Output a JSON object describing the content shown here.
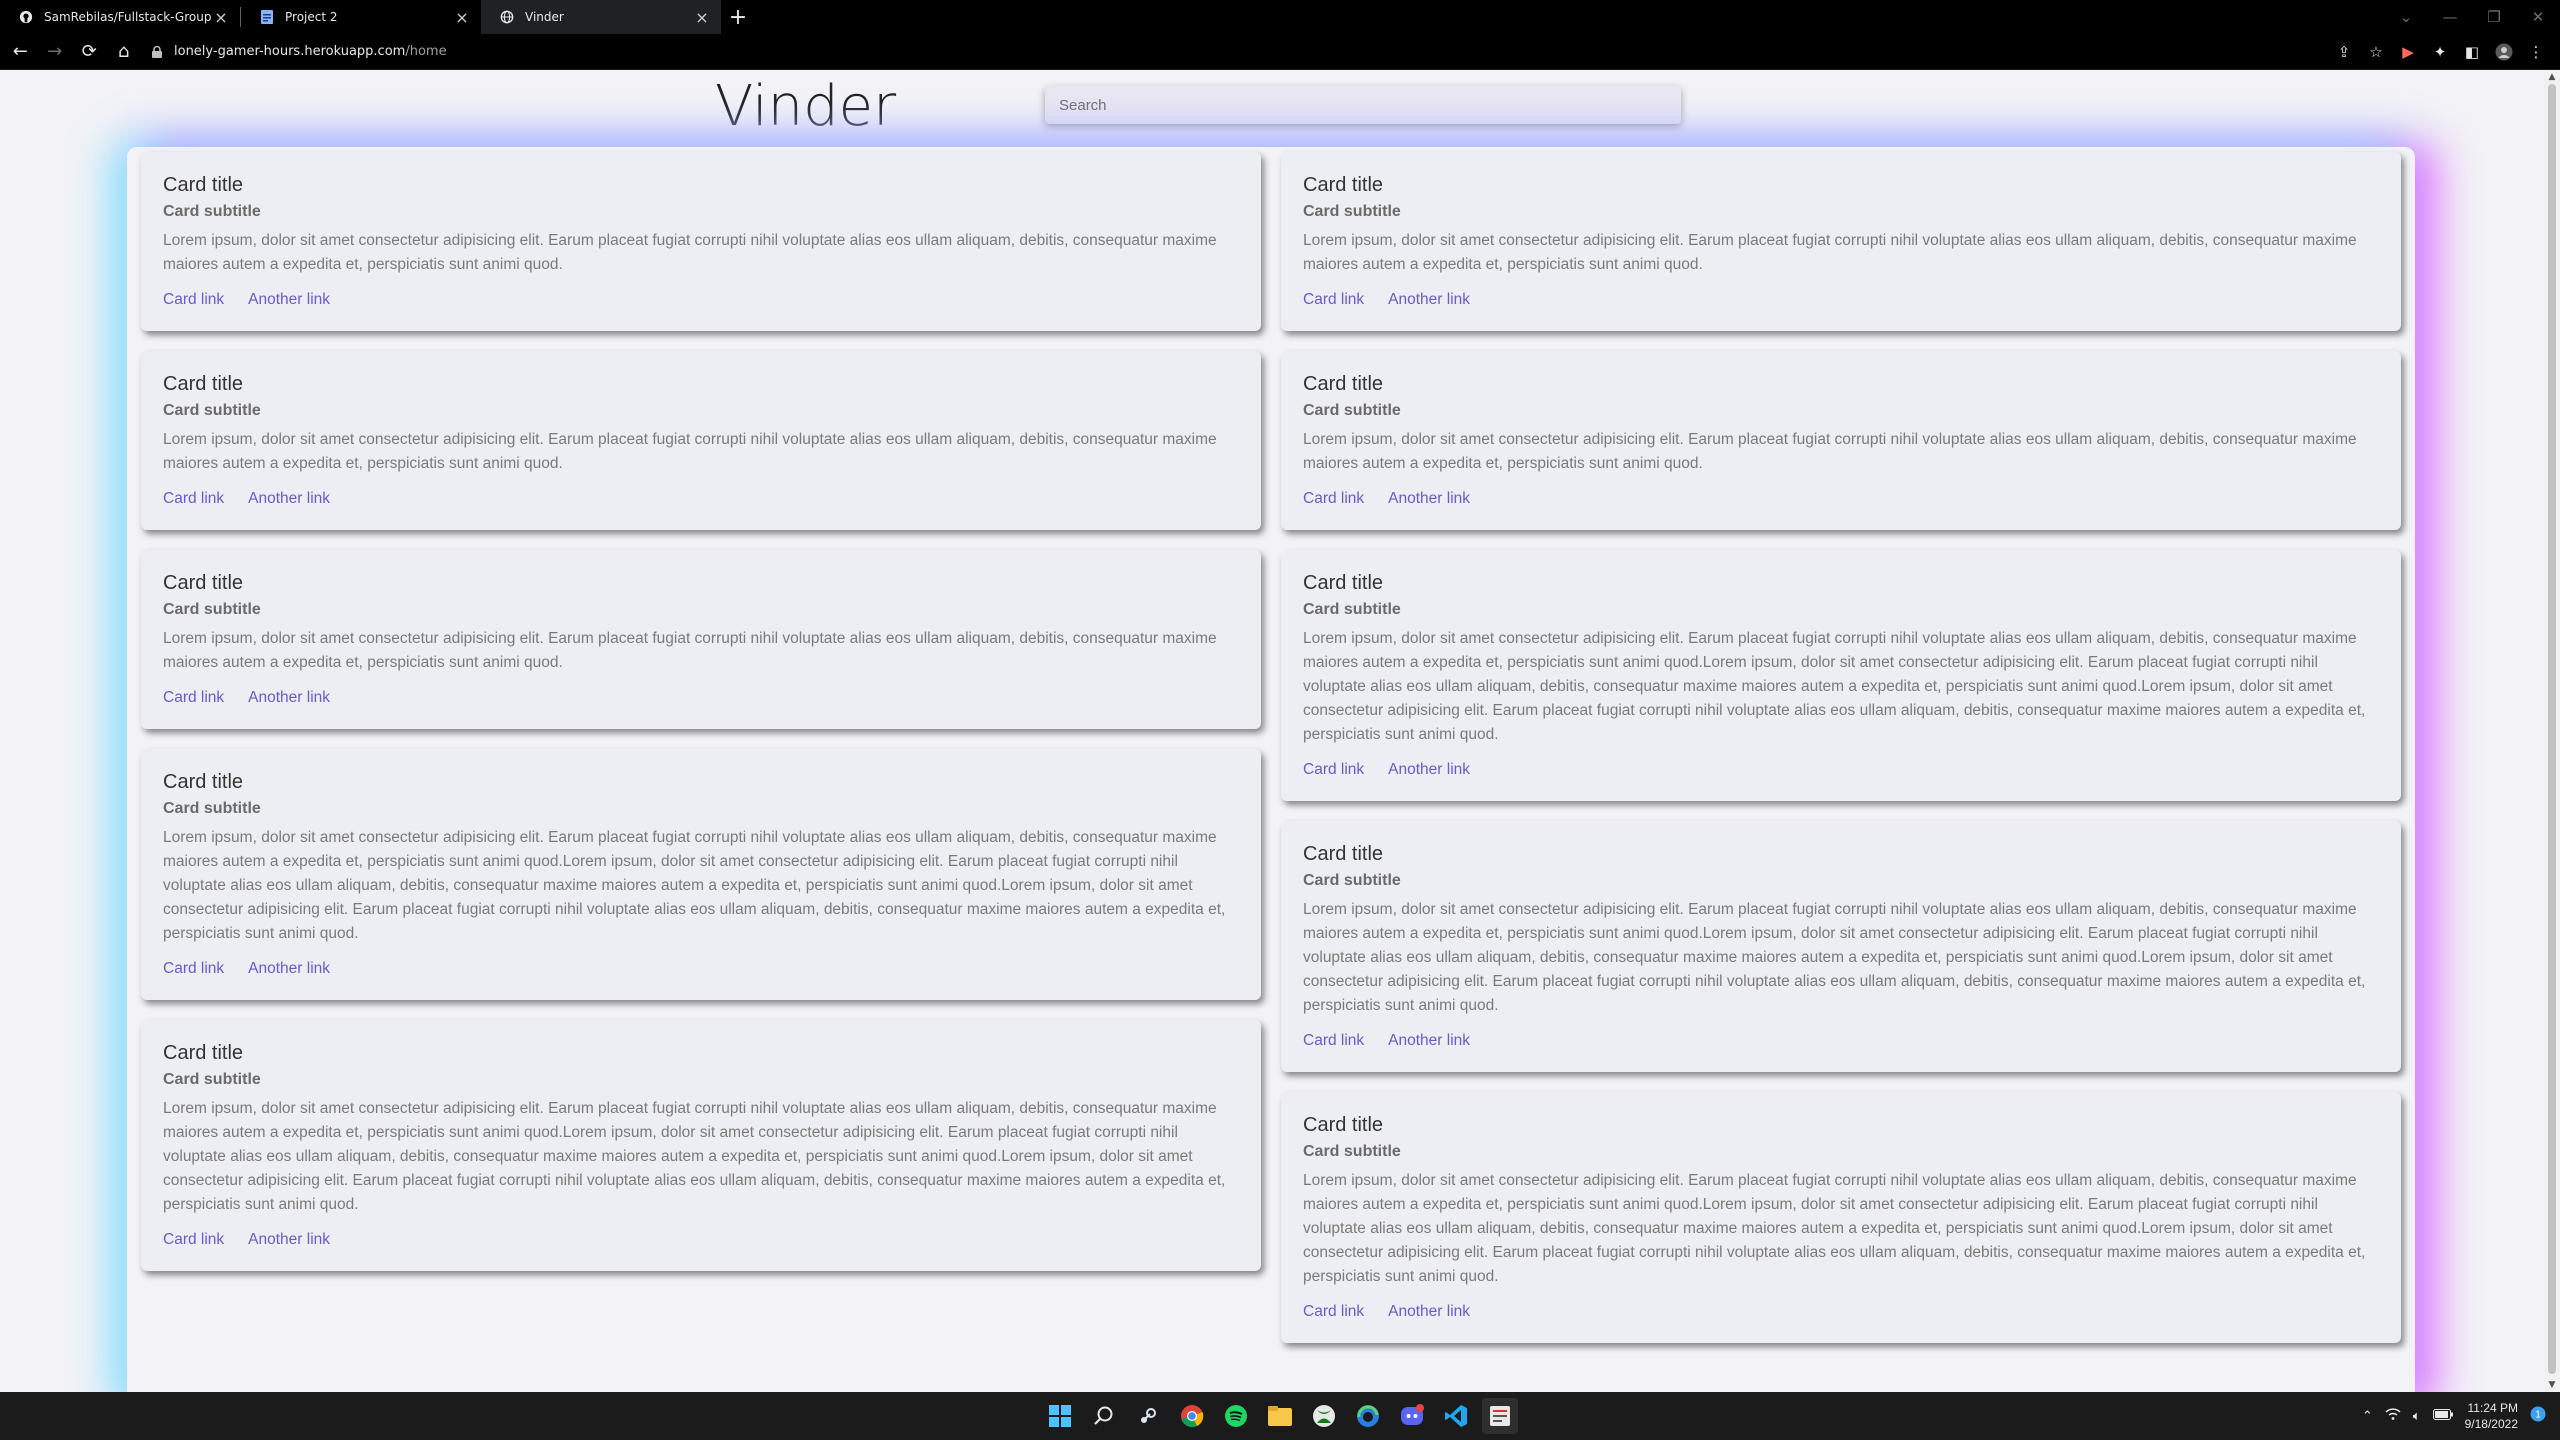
{
  "browser": {
    "tabs": [
      {
        "label": "SamRebilas/Fullstack-Group-Proj",
        "icon": "github-icon"
      },
      {
        "label": "Project 2",
        "icon": "docs-icon"
      },
      {
        "label": "Vinder",
        "icon": "globe-icon",
        "active": true
      }
    ],
    "url_host": "lonely-gamer-hours.herokuapp.com",
    "url_path": "/home"
  },
  "site": {
    "title": "Vinder",
    "search_placeholder": "Search"
  },
  "cards": {
    "left": [
      {
        "title": "Card title",
        "subtitle": "Card subtitle",
        "text": "Lorem ipsum, dolor sit amet consectetur adipisicing elit. Earum placeat fugiat corrupti nihil voluptate alias eos ullam aliquam, debitis, consequatur maxime maiores autem a expedita et, perspiciatis sunt animi quod.",
        "link1": "Card link",
        "link2": "Another link"
      },
      {
        "title": "Card title",
        "subtitle": "Card subtitle",
        "text": "Lorem ipsum, dolor sit amet consectetur adipisicing elit. Earum placeat fugiat corrupti nihil voluptate alias eos ullam aliquam, debitis, consequatur maxime maiores autem a expedita et, perspiciatis sunt animi quod.",
        "link1": "Card link",
        "link2": "Another link"
      },
      {
        "title": "Card title",
        "subtitle": "Card subtitle",
        "text": "Lorem ipsum, dolor sit amet consectetur adipisicing elit. Earum placeat fugiat corrupti nihil voluptate alias eos ullam aliquam, debitis, consequatur maxime maiores autem a expedita et, perspiciatis sunt animi quod.",
        "link1": "Card link",
        "link2": "Another link"
      },
      {
        "title": "Card title",
        "subtitle": "Card subtitle",
        "text": "Lorem ipsum, dolor sit amet consectetur adipisicing elit. Earum placeat fugiat corrupti nihil voluptate alias eos ullam aliquam, debitis, consequatur maxime maiores autem a expedita et, perspiciatis sunt animi quod.Lorem ipsum, dolor sit amet consectetur adipisicing elit. Earum placeat fugiat corrupti nihil voluptate alias eos ullam aliquam, debitis, consequatur maxime maiores autem a expedita et, perspiciatis sunt animi quod.Lorem ipsum, dolor sit amet consectetur adipisicing elit. Earum placeat fugiat corrupti nihil voluptate alias eos ullam aliquam, debitis, consequatur maxime maiores autem a expedita et, perspiciatis sunt animi quod.",
        "link1": "Card link",
        "link2": "Another link"
      },
      {
        "title": "Card title",
        "subtitle": "Card subtitle",
        "text": "Lorem ipsum, dolor sit amet consectetur adipisicing elit. Earum placeat fugiat corrupti nihil voluptate alias eos ullam aliquam, debitis, consequatur maxime maiores autem a expedita et, perspiciatis sunt animi quod.Lorem ipsum, dolor sit amet consectetur adipisicing elit. Earum placeat fugiat corrupti nihil voluptate alias eos ullam aliquam, debitis, consequatur maxime maiores autem a expedita et, perspiciatis sunt animi quod.Lorem ipsum, dolor sit amet consectetur adipisicing elit. Earum placeat fugiat corrupti nihil voluptate alias eos ullam aliquam, debitis, consequatur maxime maiores autem a expedita et, perspiciatis sunt animi quod.",
        "link1": "Card link",
        "link2": "Another link"
      }
    ],
    "right": [
      {
        "title": "Card title",
        "subtitle": "Card subtitle",
        "text": "Lorem ipsum, dolor sit amet consectetur adipisicing elit. Earum placeat fugiat corrupti nihil voluptate alias eos ullam aliquam, debitis, consequatur maxime maiores autem a expedita et, perspiciatis sunt animi quod.",
        "link1": "Card link",
        "link2": "Another link"
      },
      {
        "title": "Card title",
        "subtitle": "Card subtitle",
        "text": "Lorem ipsum, dolor sit amet consectetur adipisicing elit. Earum placeat fugiat corrupti nihil voluptate alias eos ullam aliquam, debitis, consequatur maxime maiores autem a expedita et, perspiciatis sunt animi quod.",
        "link1": "Card link",
        "link2": "Another link"
      },
      {
        "title": "Card title",
        "subtitle": "Card subtitle",
        "text": "Lorem ipsum, dolor sit amet consectetur adipisicing elit. Earum placeat fugiat corrupti nihil voluptate alias eos ullam aliquam, debitis, consequatur maxime maiores autem a expedita et, perspiciatis sunt animi quod.Lorem ipsum, dolor sit amet consectetur adipisicing elit. Earum placeat fugiat corrupti nihil voluptate alias eos ullam aliquam, debitis, consequatur maxime maiores autem a expedita et, perspiciatis sunt animi quod.Lorem ipsum, dolor sit amet consectetur adipisicing elit. Earum placeat fugiat corrupti nihil voluptate alias eos ullam aliquam, debitis, consequatur maxime maiores autem a expedita et, perspiciatis sunt animi quod.",
        "link1": "Card link",
        "link2": "Another link"
      },
      {
        "title": "Card title",
        "subtitle": "Card subtitle",
        "text": "Lorem ipsum, dolor sit amet consectetur adipisicing elit. Earum placeat fugiat corrupti nihil voluptate alias eos ullam aliquam, debitis, consequatur maxime maiores autem a expedita et, perspiciatis sunt animi quod.Lorem ipsum, dolor sit amet consectetur adipisicing elit. Earum placeat fugiat corrupti nihil voluptate alias eos ullam aliquam, debitis, consequatur maxime maiores autem a expedita et, perspiciatis sunt animi quod.Lorem ipsum, dolor sit amet consectetur adipisicing elit. Earum placeat fugiat corrupti nihil voluptate alias eos ullam aliquam, debitis, consequatur maxime maiores autem a expedita et, perspiciatis sunt animi quod.",
        "link1": "Card link",
        "link2": "Another link"
      },
      {
        "title": "Card title",
        "subtitle": "Card subtitle",
        "text": "Lorem ipsum, dolor sit amet consectetur adipisicing elit. Earum placeat fugiat corrupti nihil voluptate alias eos ullam aliquam, debitis, consequatur maxime maiores autem a expedita et, perspiciatis sunt animi quod.Lorem ipsum, dolor sit amet consectetur adipisicing elit. Earum placeat fugiat corrupti nihil voluptate alias eos ullam aliquam, debitis, consequatur maxime maiores autem a expedita et, perspiciatis sunt animi quod.Lorem ipsum, dolor sit amet consectetur adipisicing elit. Earum placeat fugiat corrupti nihil voluptate alias eos ullam aliquam, debitis, consequatur maxime maiores autem a expedita et, perspiciatis sunt animi quod.",
        "link1": "Card link",
        "link2": "Another link"
      }
    ]
  },
  "taskbar": {
    "apps": [
      "windows-start-icon",
      "search-icon",
      "steam-icon",
      "chrome-icon",
      "spotify-icon",
      "file-explorer-icon",
      "xbox-icon",
      "edge-icon",
      "discord-icon",
      "vscode-icon",
      "active-app-icon"
    ],
    "time": "11:24 PM",
    "date": "9/18/2022"
  },
  "colors": {
    "link": "#6a5acd",
    "glow_left": "#78e6ff",
    "glow_right": "#e66eff"
  }
}
